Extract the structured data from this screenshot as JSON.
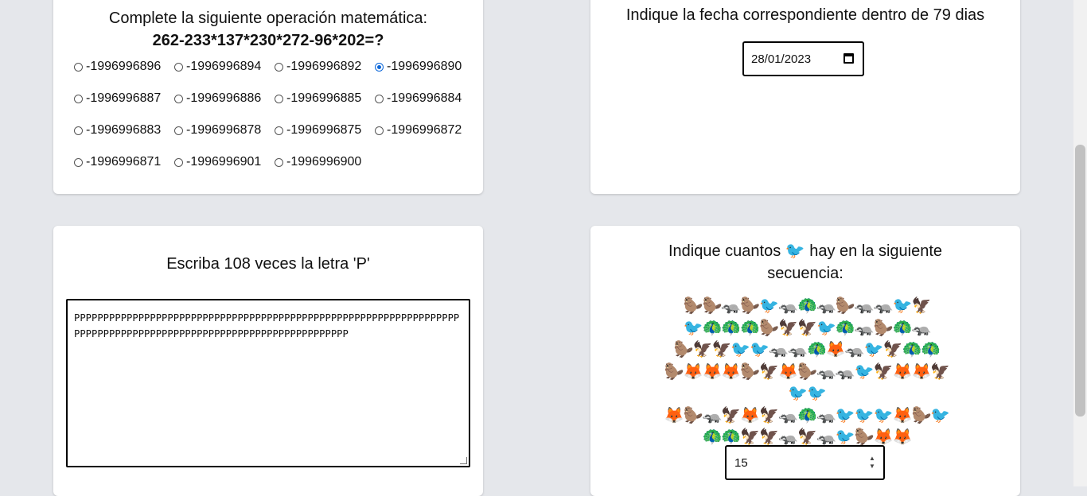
{
  "math_card": {
    "title": "Complete la siguiente operación matemática:",
    "expression": "262-233*137*230*272-96*202=?",
    "options": [
      "-1996996896",
      "-1996996894",
      "-1996996892",
      "-1996996890",
      "-1996996887",
      "-1996996886",
      "-1996996885",
      "-1996996884",
      "-1996996883",
      "-1996996878",
      "-1996996875",
      "-1996996872",
      "-1996996871",
      "-1996996901",
      "-1996996900"
    ],
    "selected_index": 3
  },
  "date_card": {
    "title": "Indique la fecha correspondiente dentro de 79 dias",
    "value": "28/01/2023",
    "icon": "calendar-icon"
  },
  "text_card": {
    "title": "Escriba 108 veces la letra 'P'",
    "value": "PPPPPPPPPPPPPPPPPPPPPPPPPPPPPPPPPPPPPPPPPPPPPPPPPPPPPPPPPPPPPPPPPPPPPPPPPPPPPPPPPPPPPPPPPPPPPPPPPPPPPPPPPPPPPPPPP"
  },
  "emoji_card": {
    "title": "Indique cuantos 🐦 hay en la siguiente secuencia:",
    "sequence_lines": [
      "🦫🦫🦡🦫🐦🦡🦚🦡🦫🦡🦡🐦🦅",
      "🐦🦚🦚🦚🦫🦅🦅🐦🦚🦡🦫🦚🦡",
      "🦫🦅🦅🐦🐦🦡🦡🦚🦊🦡🐦🦅🦚🦚",
      "🦫🦊🦊🦊🦫🦅🦊🦫🦡🦡🐦🦅🦊🦊🦅🐦🐦",
      "🦊🦫🦡🦅🦊🦅🦡🦚🦡🐦🐦🐦🦊🦫🐦",
      "🦚🦚🦅🦅🦡🦅🦡🐦🦫🦊🦊"
    ],
    "answer": "15"
  }
}
